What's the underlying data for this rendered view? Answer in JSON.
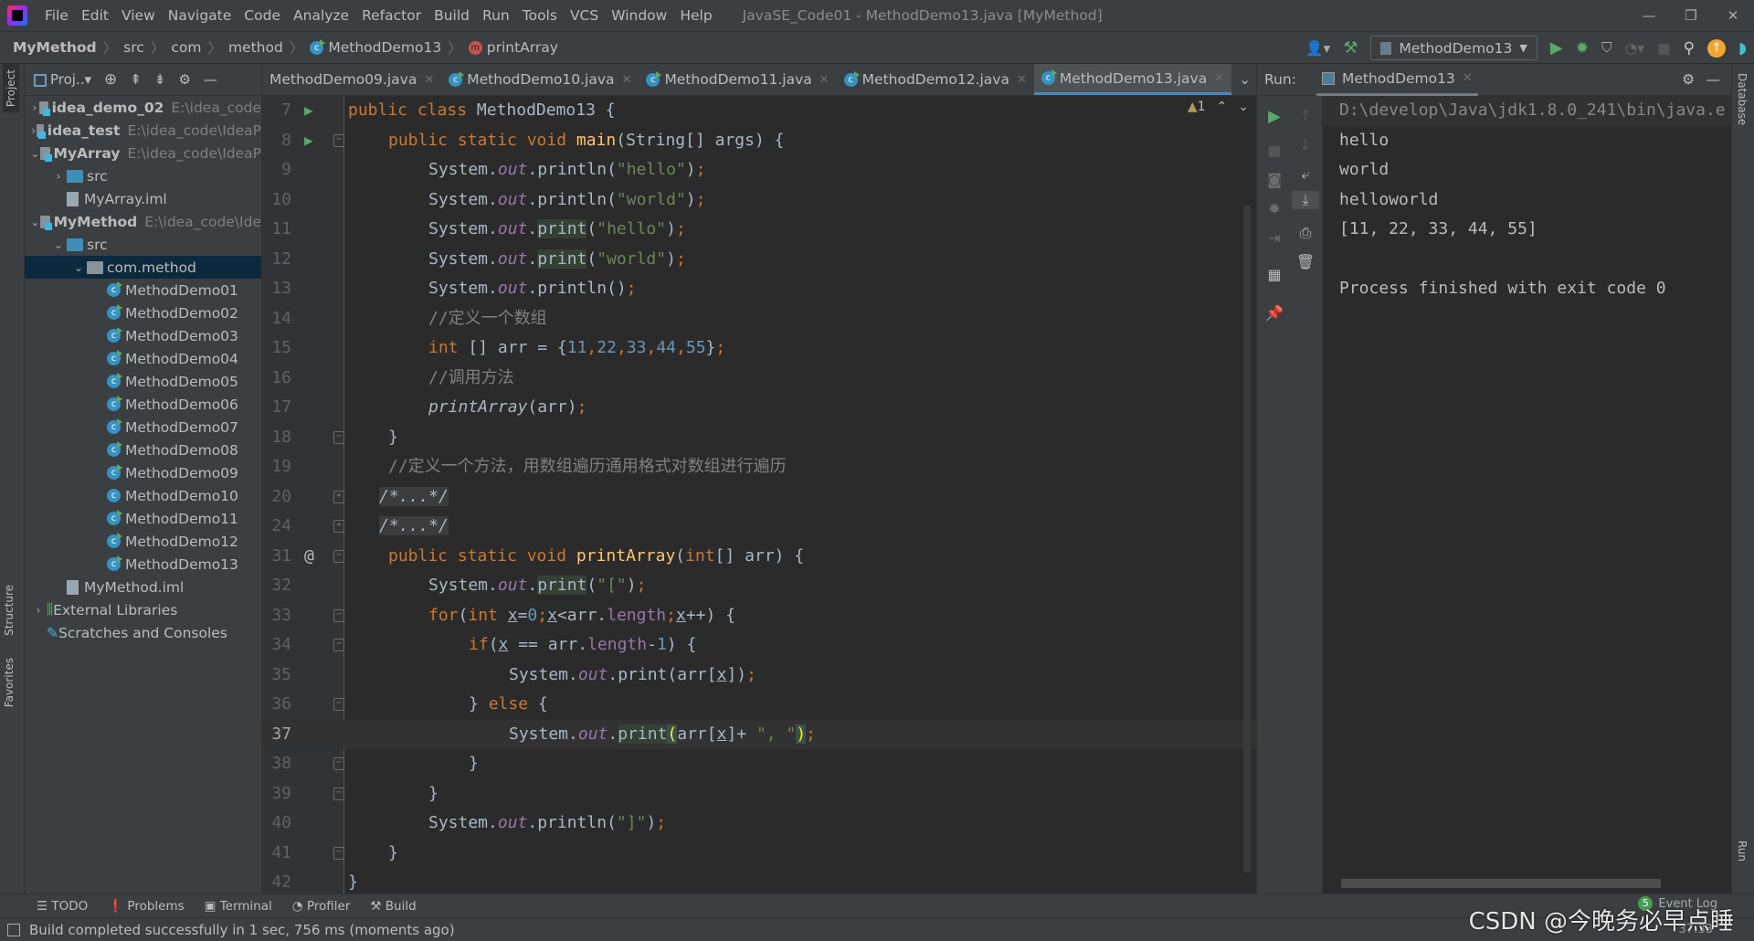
{
  "menu": {
    "items": [
      "File",
      "Edit",
      "View",
      "Navigate",
      "Code",
      "Analyze",
      "Refactor",
      "Build",
      "Run",
      "Tools",
      "VCS",
      "Window",
      "Help"
    ],
    "title": "JavaSE_Code01 - MethodDemo13.java [MyMethod]"
  },
  "breadcrumb": [
    "MyMethod",
    "src",
    "com",
    "method",
    "MethodDemo13",
    "printArray"
  ],
  "toolbar": {
    "run_config": "MethodDemo13"
  },
  "left_stripe": {
    "project": "Project",
    "structure": "Structure",
    "favorites": "Favorites"
  },
  "project": {
    "header": "Proj..",
    "tree": [
      {
        "label": "idea_demo_02",
        "path": "E:\\idea_code",
        "kind": "module",
        "arrow": "›",
        "depth": 0
      },
      {
        "label": "idea_test",
        "path": "E:\\idea_code\\IdeaP",
        "kind": "module",
        "arrow": "›",
        "depth": 0
      },
      {
        "label": "MyArray",
        "path": "E:\\idea_code\\IdeaP",
        "kind": "module",
        "arrow": "⌄",
        "depth": 0
      },
      {
        "label": "src",
        "path": "",
        "kind": "src",
        "arrow": "›",
        "depth": 1
      },
      {
        "label": "MyArray.iml",
        "path": "",
        "kind": "file",
        "arrow": "",
        "depth": 1
      },
      {
        "label": "MyMethod",
        "path": "E:\\idea_code\\Ide",
        "kind": "module",
        "arrow": "⌄",
        "depth": 0
      },
      {
        "label": "src",
        "path": "",
        "kind": "src",
        "arrow": "⌄",
        "depth": 1
      },
      {
        "label": "com.method",
        "path": "",
        "kind": "package",
        "arrow": "⌄",
        "depth": 2,
        "selected": true
      },
      {
        "label": "MethodDemo01",
        "path": "",
        "kind": "class",
        "arrow": "",
        "depth": 3
      },
      {
        "label": "MethodDemo02",
        "path": "",
        "kind": "class",
        "arrow": "",
        "depth": 3
      },
      {
        "label": "MethodDemo03",
        "path": "",
        "kind": "class",
        "arrow": "",
        "depth": 3
      },
      {
        "label": "MethodDemo04",
        "path": "",
        "kind": "class",
        "arrow": "",
        "depth": 3
      },
      {
        "label": "MethodDemo05",
        "path": "",
        "kind": "class",
        "arrow": "",
        "depth": 3
      },
      {
        "label": "MethodDemo06",
        "path": "",
        "kind": "class",
        "arrow": "",
        "depth": 3
      },
      {
        "label": "MethodDemo07",
        "path": "",
        "kind": "class",
        "arrow": "",
        "depth": 3
      },
      {
        "label": "MethodDemo08",
        "path": "",
        "kind": "class",
        "arrow": "",
        "depth": 3
      },
      {
        "label": "MethodDemo09",
        "path": "",
        "kind": "class",
        "arrow": "",
        "depth": 3
      },
      {
        "label": "MethodDemo10",
        "path": "",
        "kind": "class",
        "arrow": "",
        "depth": 3
      },
      {
        "label": "MethodDemo11",
        "path": "",
        "kind": "class",
        "arrow": "",
        "depth": 3
      },
      {
        "label": "MethodDemo12",
        "path": "",
        "kind": "class",
        "arrow": "",
        "depth": 3
      },
      {
        "label": "MethodDemo13",
        "path": "",
        "kind": "class",
        "arrow": "",
        "depth": 3
      },
      {
        "label": "MyMethod.iml",
        "path": "",
        "kind": "file",
        "arrow": "",
        "depth": 1
      },
      {
        "label": "External Libraries",
        "path": "",
        "kind": "lib",
        "arrow": "›",
        "depth": 0
      },
      {
        "label": "Scratches and Consoles",
        "path": "",
        "kind": "scratch",
        "arrow": "",
        "depth": 0
      }
    ]
  },
  "editor": {
    "tabs": [
      {
        "label": "MethodDemo09.java",
        "active": false,
        "icon": false
      },
      {
        "label": "MethodDemo10.java",
        "active": false,
        "icon": true
      },
      {
        "label": "MethodDemo11.java",
        "active": false,
        "icon": true
      },
      {
        "label": "MethodDemo12.java",
        "active": false,
        "icon": true
      },
      {
        "label": "MethodDemo13.java",
        "active": true,
        "icon": true
      }
    ],
    "warnings": "1",
    "current_line": "37",
    "lines": [
      {
        "n": "7",
        "mark": "run",
        "fold": "",
        "indent": 0,
        "tokens": [
          [
            "kw",
            "public class "
          ],
          [
            "pl",
            "MethodDemo13 {"
          ]
        ]
      },
      {
        "n": "8",
        "mark": "run",
        "fold": "−",
        "indent": 1,
        "tokens": [
          [
            "kw",
            "public static void "
          ],
          [
            "fn",
            "main"
          ],
          [
            "pl",
            "(String[] args) {"
          ]
        ]
      },
      {
        "n": "9",
        "mark": "",
        "fold": "",
        "indent": 2,
        "tokens": [
          [
            "pl",
            "System."
          ],
          [
            "fld",
            "out"
          ],
          [
            "pl",
            ".println("
          ],
          [
            "str",
            "\"hello\""
          ],
          [
            "pl",
            ")"
          ],
          [
            "kw",
            ";"
          ]
        ]
      },
      {
        "n": "10",
        "mark": "",
        "fold": "",
        "indent": 2,
        "tokens": [
          [
            "pl",
            "System."
          ],
          [
            "fld",
            "out"
          ],
          [
            "pl",
            ".println("
          ],
          [
            "str",
            "\"world\""
          ],
          [
            "pl",
            ")"
          ],
          [
            "kw",
            ";"
          ]
        ]
      },
      {
        "n": "11",
        "mark": "",
        "fold": "",
        "indent": 2,
        "tokens": [
          [
            "pl",
            "System."
          ],
          [
            "fld",
            "out"
          ],
          [
            "pl",
            "."
          ],
          [
            "hl",
            "print"
          ],
          [
            "pl",
            "("
          ],
          [
            "str",
            "\"hello\""
          ],
          [
            "pl",
            ")"
          ],
          [
            "kw",
            ";"
          ]
        ]
      },
      {
        "n": "12",
        "mark": "",
        "fold": "",
        "indent": 2,
        "tokens": [
          [
            "pl",
            "System."
          ],
          [
            "fld",
            "out"
          ],
          [
            "pl",
            "."
          ],
          [
            "hl",
            "print"
          ],
          [
            "pl",
            "("
          ],
          [
            "str",
            "\"world\""
          ],
          [
            "pl",
            ")"
          ],
          [
            "kw",
            ";"
          ]
        ]
      },
      {
        "n": "13",
        "mark": "",
        "fold": "",
        "indent": 2,
        "tokens": [
          [
            "pl",
            "System."
          ],
          [
            "fld",
            "out"
          ],
          [
            "pl",
            ".println()"
          ],
          [
            "kw",
            ";"
          ]
        ]
      },
      {
        "n": "14",
        "mark": "",
        "fold": "",
        "indent": 2,
        "tokens": [
          [
            "cm",
            "//定义一个数组"
          ]
        ]
      },
      {
        "n": "15",
        "mark": "",
        "fold": "",
        "indent": 2,
        "tokens": [
          [
            "kw",
            "int "
          ],
          [
            "pl",
            "[] arr = {"
          ],
          [
            "num",
            "11"
          ],
          [
            "kw",
            ","
          ],
          [
            "num",
            "22"
          ],
          [
            "kw",
            ","
          ],
          [
            "num",
            "33"
          ],
          [
            "kw",
            ","
          ],
          [
            "num",
            "44"
          ],
          [
            "kw",
            ","
          ],
          [
            "num",
            "55"
          ],
          [
            "pl",
            "}"
          ],
          [
            "kw",
            ";"
          ]
        ]
      },
      {
        "n": "16",
        "mark": "",
        "fold": "",
        "indent": 2,
        "tokens": [
          [
            "cm",
            "//调用方法"
          ]
        ]
      },
      {
        "n": "17",
        "mark": "",
        "fold": "",
        "indent": 2,
        "tokens": [
          [
            "it",
            "printArray"
          ],
          [
            "pl",
            "(arr)"
          ],
          [
            "kw",
            ";"
          ]
        ]
      },
      {
        "n": "18",
        "mark": "",
        "fold": "−",
        "indent": 1,
        "tokens": [
          [
            "pl",
            "}"
          ]
        ]
      },
      {
        "n": "19",
        "mark": "",
        "fold": "",
        "indent": 1,
        "tokens": [
          [
            "cm",
            "//定义一个方法，用数组遍历通用格式对数组进行遍历"
          ]
        ]
      },
      {
        "n": "20",
        "mark": "",
        "fold": "+",
        "indent": 1,
        "tokens": [
          [
            "fl",
            "/*...*/"
          ]
        ]
      },
      {
        "n": "24",
        "mark": "",
        "fold": "+",
        "indent": 1,
        "tokens": [
          [
            "fl",
            "/*...*/"
          ]
        ]
      },
      {
        "n": "31",
        "mark": "at",
        "fold": "−",
        "indent": 1,
        "tokens": [
          [
            "kw",
            "public static void "
          ],
          [
            "fn",
            "printArray"
          ],
          [
            "pl",
            "("
          ],
          [
            "kw",
            "int"
          ],
          [
            "pl",
            "[] arr) {"
          ]
        ]
      },
      {
        "n": "32",
        "mark": "",
        "fold": "",
        "indent": 2,
        "tokens": [
          [
            "pl",
            "System."
          ],
          [
            "fld",
            "out"
          ],
          [
            "pl",
            "."
          ],
          [
            "hl",
            "print"
          ],
          [
            "pl",
            "("
          ],
          [
            "str",
            "\"[\""
          ],
          [
            "pl",
            ")"
          ],
          [
            "kw",
            ";"
          ]
        ]
      },
      {
        "n": "33",
        "mark": "",
        "fold": "−",
        "indent": 2,
        "tokens": [
          [
            "kw",
            "for"
          ],
          [
            "pl",
            "("
          ],
          [
            "kw",
            "int "
          ],
          [
            "u",
            "x"
          ],
          [
            "pl",
            "="
          ],
          [
            "num",
            "0"
          ],
          [
            "kw",
            ";"
          ],
          [
            "u",
            "x"
          ],
          [
            "pl",
            "<arr."
          ],
          [
            "prop",
            "length"
          ],
          [
            "kw",
            ";"
          ],
          [
            "u",
            "x"
          ],
          [
            "pl",
            "++) {"
          ]
        ]
      },
      {
        "n": "34",
        "mark": "",
        "fold": "−",
        "indent": 3,
        "tokens": [
          [
            "kw",
            "if"
          ],
          [
            "pl",
            "("
          ],
          [
            "u",
            "x"
          ],
          [
            "pl",
            " == arr."
          ],
          [
            "prop",
            "length"
          ],
          [
            "pl",
            "-"
          ],
          [
            "num",
            "1"
          ],
          [
            "pl",
            ") {"
          ]
        ]
      },
      {
        "n": "35",
        "mark": "",
        "fold": "",
        "indent": 4,
        "tokens": [
          [
            "pl",
            "System."
          ],
          [
            "fld",
            "out"
          ],
          [
            "pl",
            ".print(arr["
          ],
          [
            "u",
            "x"
          ],
          [
            "pl",
            "])"
          ],
          [
            "kw",
            ";"
          ]
        ]
      },
      {
        "n": "36",
        "mark": "",
        "fold": "−",
        "indent": 3,
        "tokens": [
          [
            "pl",
            "} "
          ],
          [
            "kw",
            "else"
          ],
          [
            "pl",
            " {"
          ]
        ]
      },
      {
        "n": "37",
        "mark": "",
        "fold": "",
        "indent": 4,
        "tokens": [
          [
            "pl",
            "System."
          ],
          [
            "fld",
            "out"
          ],
          [
            "pl",
            "."
          ],
          [
            "hl",
            "print"
          ],
          [
            "brace",
            "("
          ],
          [
            "pl",
            "arr["
          ],
          [
            "u",
            "x"
          ],
          [
            "pl",
            "]+ "
          ],
          [
            "str",
            "\", \""
          ],
          [
            "brace",
            ")"
          ],
          [
            "kw",
            ";"
          ]
        ]
      },
      {
        "n": "38",
        "mark": "",
        "fold": "−",
        "indent": 3,
        "tokens": [
          [
            "pl",
            "}"
          ]
        ]
      },
      {
        "n": "39",
        "mark": "",
        "fold": "−",
        "indent": 2,
        "tokens": [
          [
            "pl",
            "}"
          ]
        ]
      },
      {
        "n": "40",
        "mark": "",
        "fold": "",
        "indent": 2,
        "tokens": [
          [
            "pl",
            "System."
          ],
          [
            "fld",
            "out"
          ],
          [
            "pl",
            ".println("
          ],
          [
            "str",
            "\"]\""
          ],
          [
            "pl",
            ")"
          ],
          [
            "kw",
            ";"
          ]
        ]
      },
      {
        "n": "41",
        "mark": "",
        "fold": "−",
        "indent": 1,
        "tokens": [
          [
            "pl",
            "}"
          ]
        ]
      },
      {
        "n": "42",
        "mark": "",
        "fold": "",
        "indent": 0,
        "tokens": [
          [
            "pl",
            "}"
          ]
        ]
      }
    ]
  },
  "run": {
    "label": "Run:",
    "tab": "MethodDemo13",
    "output": [
      "D:\\develop\\Java\\jdk1.8.0_241\\bin\\java.e",
      "hello",
      "world",
      "helloworld",
      "[11, 22, 33, 44, 55]",
      "",
      "Process finished with exit code 0"
    ]
  },
  "right_stripe": {
    "database": "Database",
    "run": "Run"
  },
  "bottom_tools": [
    "TODO",
    "Problems",
    "Terminal",
    "Profiler",
    "Build"
  ],
  "status": {
    "message": "Build completed successfully in 1 sec, 756 ms (moments ago)",
    "event_log": "Event Log",
    "event_count": "5",
    "caret": "37:33"
  },
  "watermark": "CSDN @今晚务必早点睡",
  "colors": {
    "accent": "#4a88c7",
    "run_green": "#59a869",
    "selection": "#0d293e"
  }
}
